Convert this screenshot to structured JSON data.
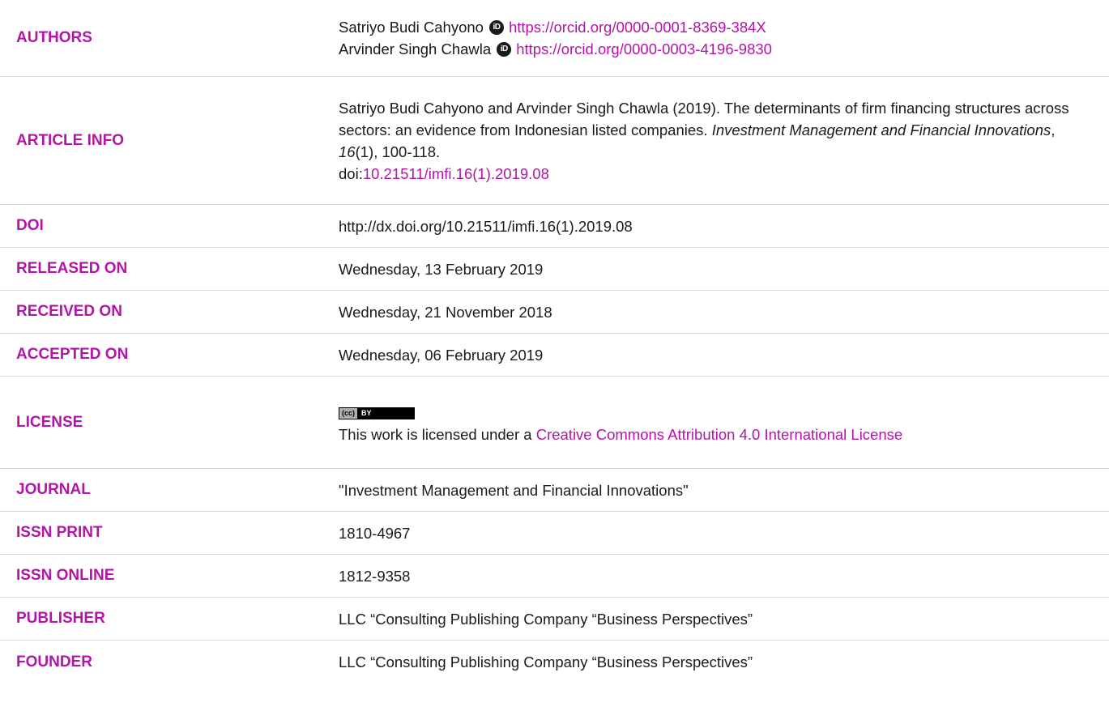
{
  "rows": {
    "authors": {
      "label": "AUTHORS",
      "list": [
        {
          "name": "Satriyo Budi Cahyono",
          "orcid_url": "https://orcid.org/0000-0001-8369-384X"
        },
        {
          "name": "Arvinder Singh Chawla",
          "orcid_url": "https://orcid.org/0000-0003-4196-9830"
        }
      ]
    },
    "article_info": {
      "label": "ARTICLE INFO",
      "citation_prefix": "Satriyo Budi Cahyono and Arvinder Singh Chawla (2019). The determinants of firm financing structures across sectors: an evidence from Indonesian listed companies. ",
      "journal_italic": "Investment Management and Financial Innovations",
      "sep1": ", ",
      "volume_italic": "16",
      "issue_pages": "(1), 100-118.",
      "doi_prefix": "doi:",
      "doi_link": "10.21511/imfi.16(1).2019.08"
    },
    "doi": {
      "label": "DOI",
      "value": "http://dx.doi.org/10.21511/imfi.16(1).2019.08"
    },
    "released_on": {
      "label": "RELEASED ON",
      "value": "Wednesday, 13 February 2019"
    },
    "received_on": {
      "label": "RECEIVED ON",
      "value": "Wednesday, 21 November 2018"
    },
    "accepted_on": {
      "label": "ACCEPTED ON",
      "value": "Wednesday, 06 February 2019"
    },
    "license": {
      "label": "LICENSE",
      "badge_left": "(cc)",
      "badge_right": "BY",
      "text_prefix": "This work is licensed under a ",
      "link_text": "Creative Commons Attribution 4.0 International License"
    },
    "journal": {
      "label": "JOURNAL",
      "value": "\"Investment Management and Financial Innovations\""
    },
    "issn_print": {
      "label": "ISSN PRINT",
      "value": "1810-4967"
    },
    "issn_online": {
      "label": "ISSN ONLINE",
      "value": "1812-9358"
    },
    "publisher": {
      "label": "PUBLISHER",
      "value": "LLC “Consulting Publishing Company “Business Perspectives”"
    },
    "founder": {
      "label": "FOUNDER",
      "value": "LLC “Consulting Publishing Company “Business Perspectives”"
    }
  },
  "icons": {
    "orcid": "orcid-icon",
    "orcid_glyph": "iD"
  },
  "colors": {
    "accent": "#b414a8",
    "text": "#1a1a1a",
    "divider": "#d9d9d9"
  }
}
